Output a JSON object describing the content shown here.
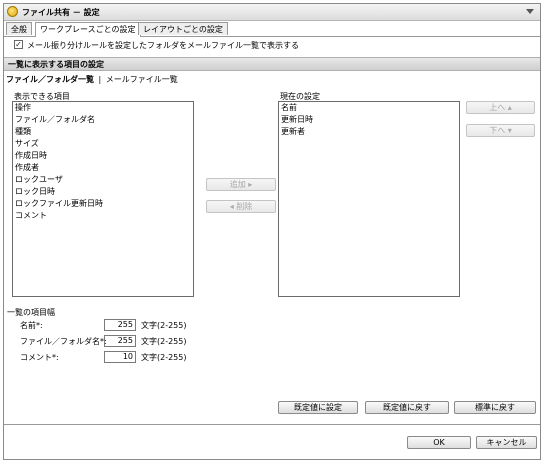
{
  "window": {
    "title": "ファイル共有 － 設定"
  },
  "tabs": [
    {
      "label": "全般"
    },
    {
      "label": "ワークプレースごとの設定"
    },
    {
      "label": "レイアウトごとの設定"
    }
  ],
  "mail_rule_option": {
    "label": "メール振り分けルールを設定したフォルダをメールファイル一覧で表示する",
    "checked": true
  },
  "section": {
    "title": "一覧に表示する項目の設定"
  },
  "subtabs": {
    "active": "ファイル／フォルダ一覧",
    "separator": "|",
    "other": "メールファイル一覧"
  },
  "available": {
    "label": "表示できる項目",
    "items": [
      "操作",
      "ファイル／フォルダ名",
      "種類",
      "サイズ",
      "作成日時",
      "作成者",
      "ロックユーザ",
      "ロック日時",
      "ロックファイル更新日時",
      "コメント"
    ]
  },
  "current": {
    "label": "現在の設定",
    "items": [
      "名前",
      "更新日時",
      "更新者"
    ]
  },
  "buttons": {
    "add": "追加 ▸",
    "remove": "◂ 削除",
    "up": "上へ ▴",
    "down": "下へ ▾",
    "set_default": "既定値に設定",
    "restore_default": "既定値に戻す",
    "restore_standard": "標準に戻す",
    "ok": "OK",
    "cancel": "キャンセル"
  },
  "widths": {
    "title": "一覧の項目幅",
    "fields": [
      {
        "label": "名前*:",
        "value": "255",
        "unit": "文字(2-255)"
      },
      {
        "label": "ファイル／フォルダ名*:",
        "value": "255",
        "unit": "文字(2-255)"
      },
      {
        "label": "コメント*:",
        "value": "10",
        "unit": "文字(2-255)"
      }
    ]
  }
}
